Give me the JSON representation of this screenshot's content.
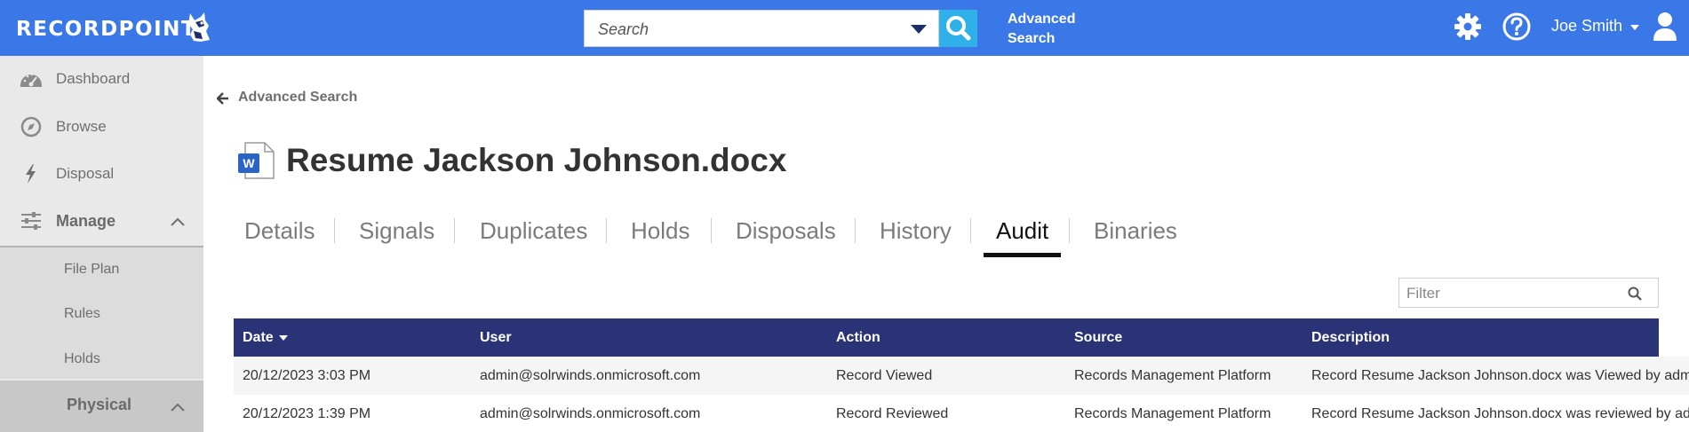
{
  "header": {
    "logo_text": "RECORDPOINT",
    "search_placeholder": "Search",
    "advanced_search_label": "Advanced Search",
    "user_name": "Joe Smith",
    "colors": {
      "bar": "#3b78e7",
      "search_button": "#30b0e8"
    }
  },
  "sidebar": {
    "items": [
      {
        "label": "Dashboard",
        "icon": "dashboard-icon"
      },
      {
        "label": "Browse",
        "icon": "compass-icon"
      },
      {
        "label": "Disposal",
        "icon": "bolt-icon"
      },
      {
        "label": "Manage",
        "icon": "sliders-icon"
      }
    ],
    "manage_subitems": [
      "File Plan",
      "Rules",
      "Holds"
    ],
    "physical_label": "Physical"
  },
  "main": {
    "back_label": "Advanced Search",
    "document_title": "Resume Jackson Johnson.docx",
    "tabs": [
      "Details",
      "Signals",
      "Duplicates",
      "Holds",
      "Disposals",
      "History",
      "Audit",
      "Binaries"
    ],
    "active_tab": "Audit",
    "filter_placeholder": "Filter",
    "table": {
      "columns": [
        "Date",
        "User",
        "Action",
        "Source",
        "Description"
      ],
      "sort_column": "Date",
      "rows": [
        [
          "20/12/2023 3:03 PM",
          "admin@solrwinds.onmicrosoft.com",
          "Record Viewed",
          "Records Management Platform",
          "Record Resume Jackson Johnson.docx was Viewed by admin"
        ],
        [
          "20/12/2023 1:39 PM",
          "admin@solrwinds.onmicrosoft.com",
          "Record Reviewed",
          "Records Management Platform",
          "Record Resume Jackson Johnson.docx was reviewed by admin"
        ]
      ],
      "header_color": "#2b3377"
    }
  }
}
